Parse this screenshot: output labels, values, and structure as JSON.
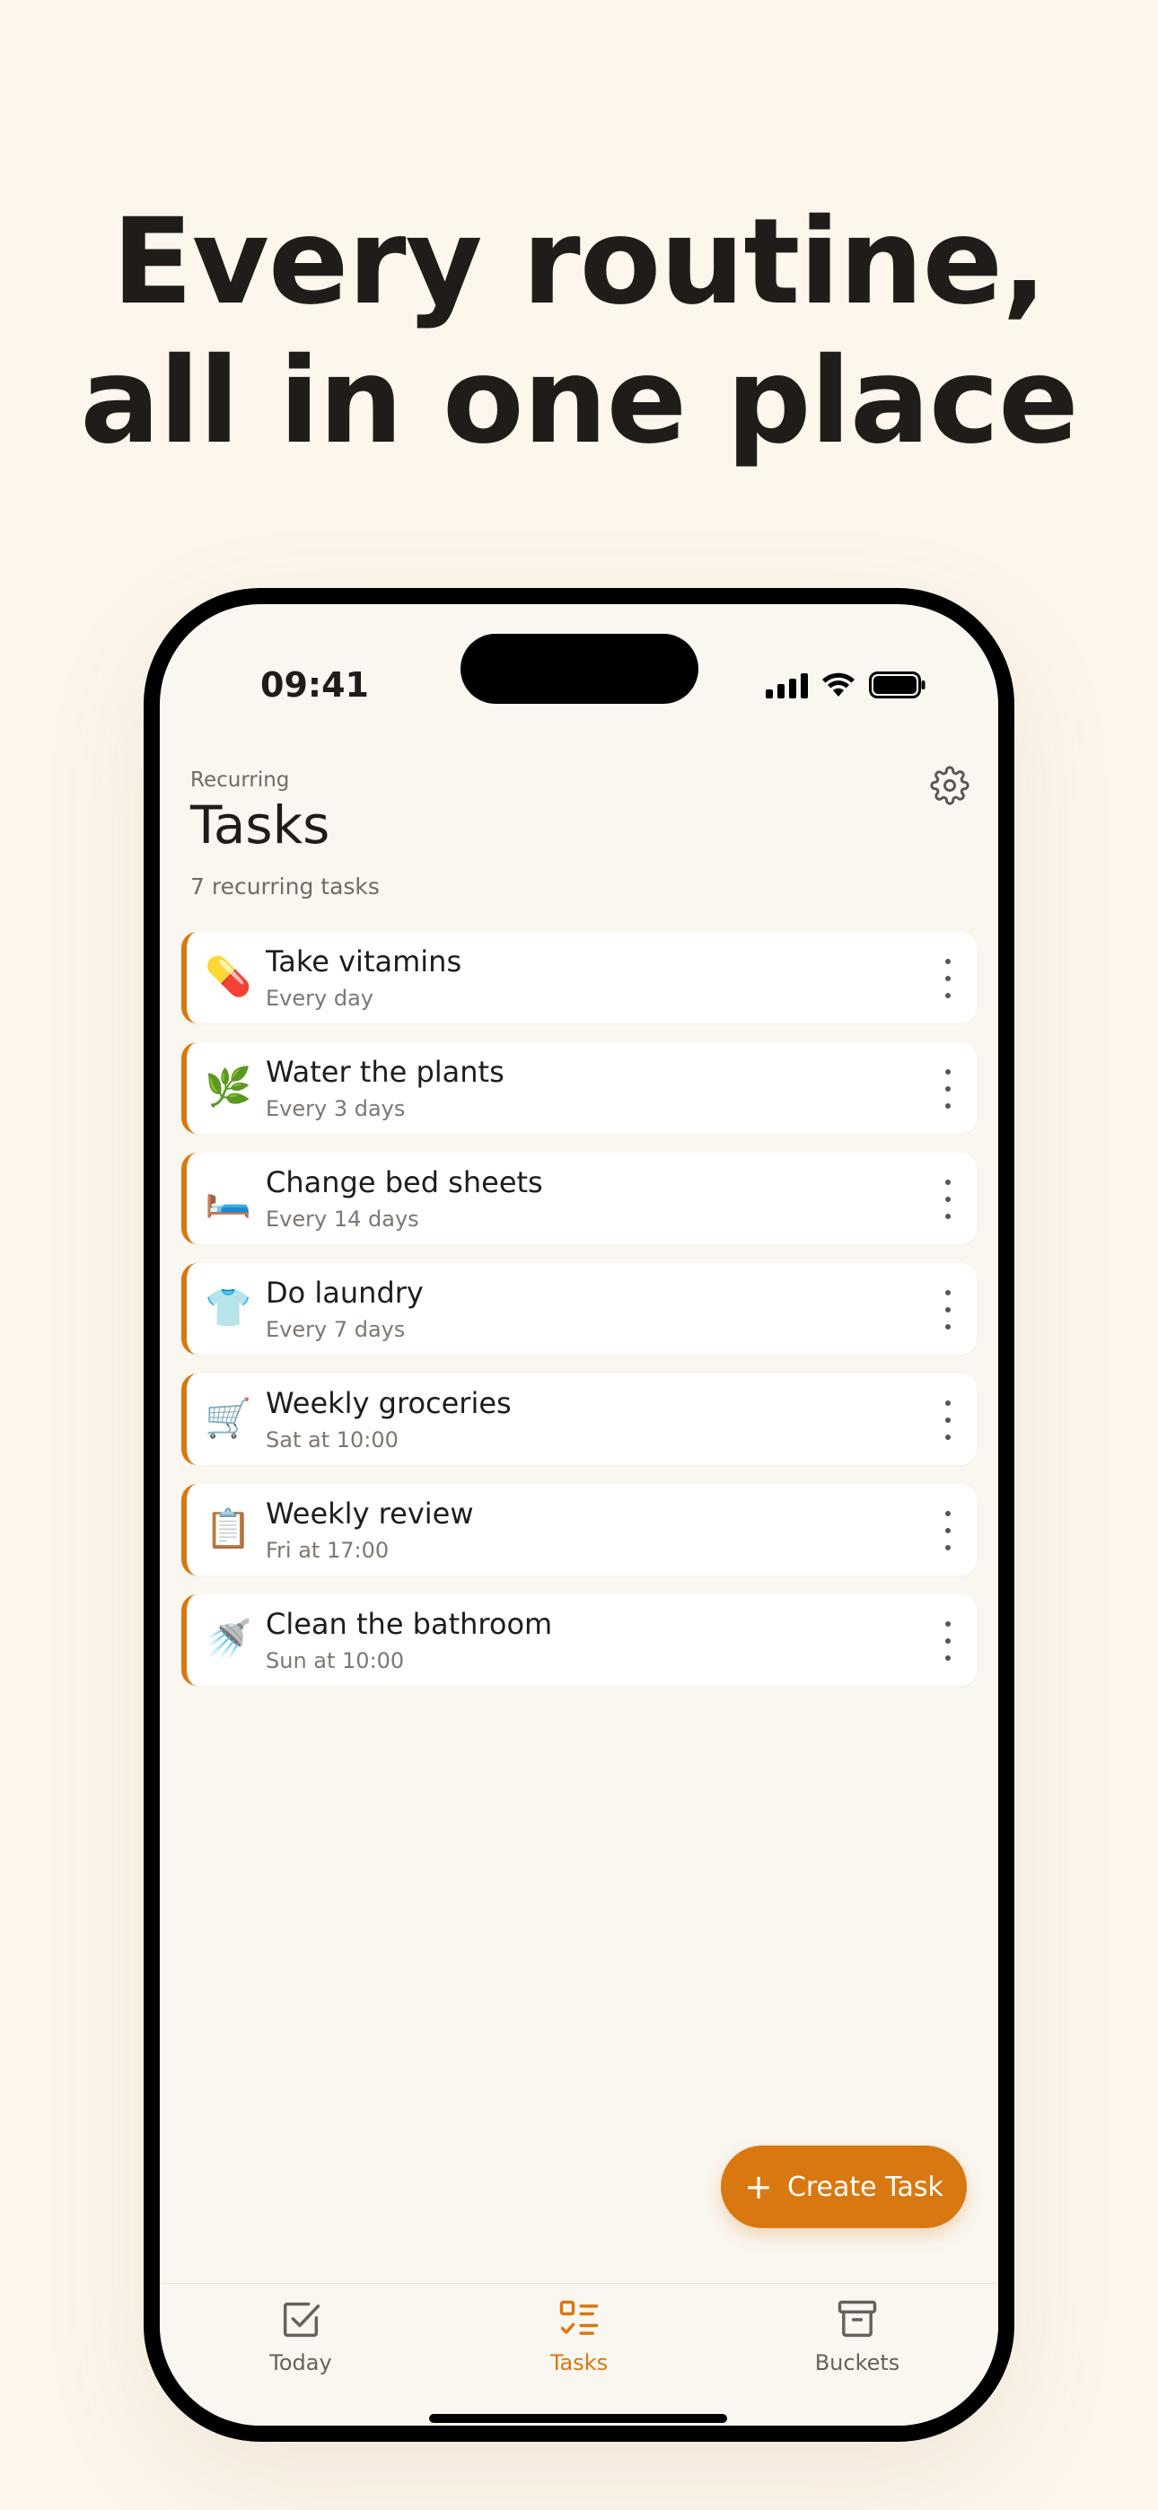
{
  "headline": {
    "line1": "Every routine,",
    "line2": "all in one place"
  },
  "status_bar": {
    "time": "09:41"
  },
  "header": {
    "subtitle": "Recurring",
    "title": "Tasks",
    "count": "7 recurring tasks"
  },
  "tasks": [
    {
      "emoji": "💊",
      "title": "Take vitamins",
      "schedule": "Every day"
    },
    {
      "emoji": "🌿",
      "title": "Water the plants",
      "schedule": "Every 3 days"
    },
    {
      "emoji": "🛏️",
      "title": "Change bed sheets",
      "schedule": "Every 14 days"
    },
    {
      "emoji": "👕",
      "title": "Do laundry",
      "schedule": "Every 7 days"
    },
    {
      "emoji": "🛒",
      "title": "Weekly groceries",
      "schedule": "Sat at 10:00"
    },
    {
      "emoji": "📋",
      "title": "Weekly review",
      "schedule": "Fri at 17:00"
    },
    {
      "emoji": "🚿",
      "title": "Clean the bathroom",
      "schedule": "Sun at 10:00"
    }
  ],
  "fab": {
    "label": "Create Task",
    "icon": "plus-icon"
  },
  "tabbar": {
    "items": [
      {
        "label": "Today",
        "icon": "checkbox-icon",
        "active": false
      },
      {
        "label": "Tasks",
        "icon": "list-check-icon",
        "active": true
      },
      {
        "label": "Buckets",
        "icon": "archive-box-icon",
        "active": false
      }
    ]
  },
  "colors": {
    "accent": "#d97810",
    "background": "#fdf6ec",
    "screen": "#faf6f0",
    "card": "#ffffff",
    "text": "#1f1c19",
    "muted": "#7d7770"
  }
}
